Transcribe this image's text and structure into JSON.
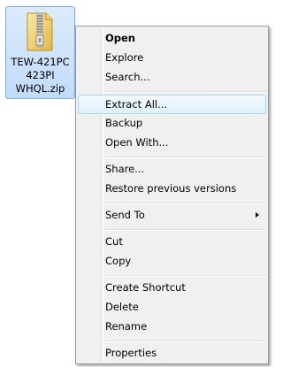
{
  "file": {
    "name_lines": [
      "TEW-421PC",
      "423PI",
      "WHQL.zip"
    ],
    "icon": "zip-folder-icon"
  },
  "menu": {
    "open": "Open",
    "explore": "Explore",
    "search": "Search...",
    "extract_all": "Extract All...",
    "backup": "Backup",
    "open_with": "Open With...",
    "share": "Share...",
    "restore_previous_versions": "Restore previous versions",
    "send_to": "Send To",
    "cut": "Cut",
    "copy": "Copy",
    "create_shortcut": "Create Shortcut",
    "delete": "Delete",
    "rename": "Rename",
    "properties": "Properties",
    "submenu_icon": "chevron-right-icon"
  },
  "colors": {
    "selection_border": "#84acdd",
    "selection_fill": "#c1dbfc",
    "menu_background": "#f0f0f0",
    "menu_highlight_border": "#a8d8eb"
  }
}
